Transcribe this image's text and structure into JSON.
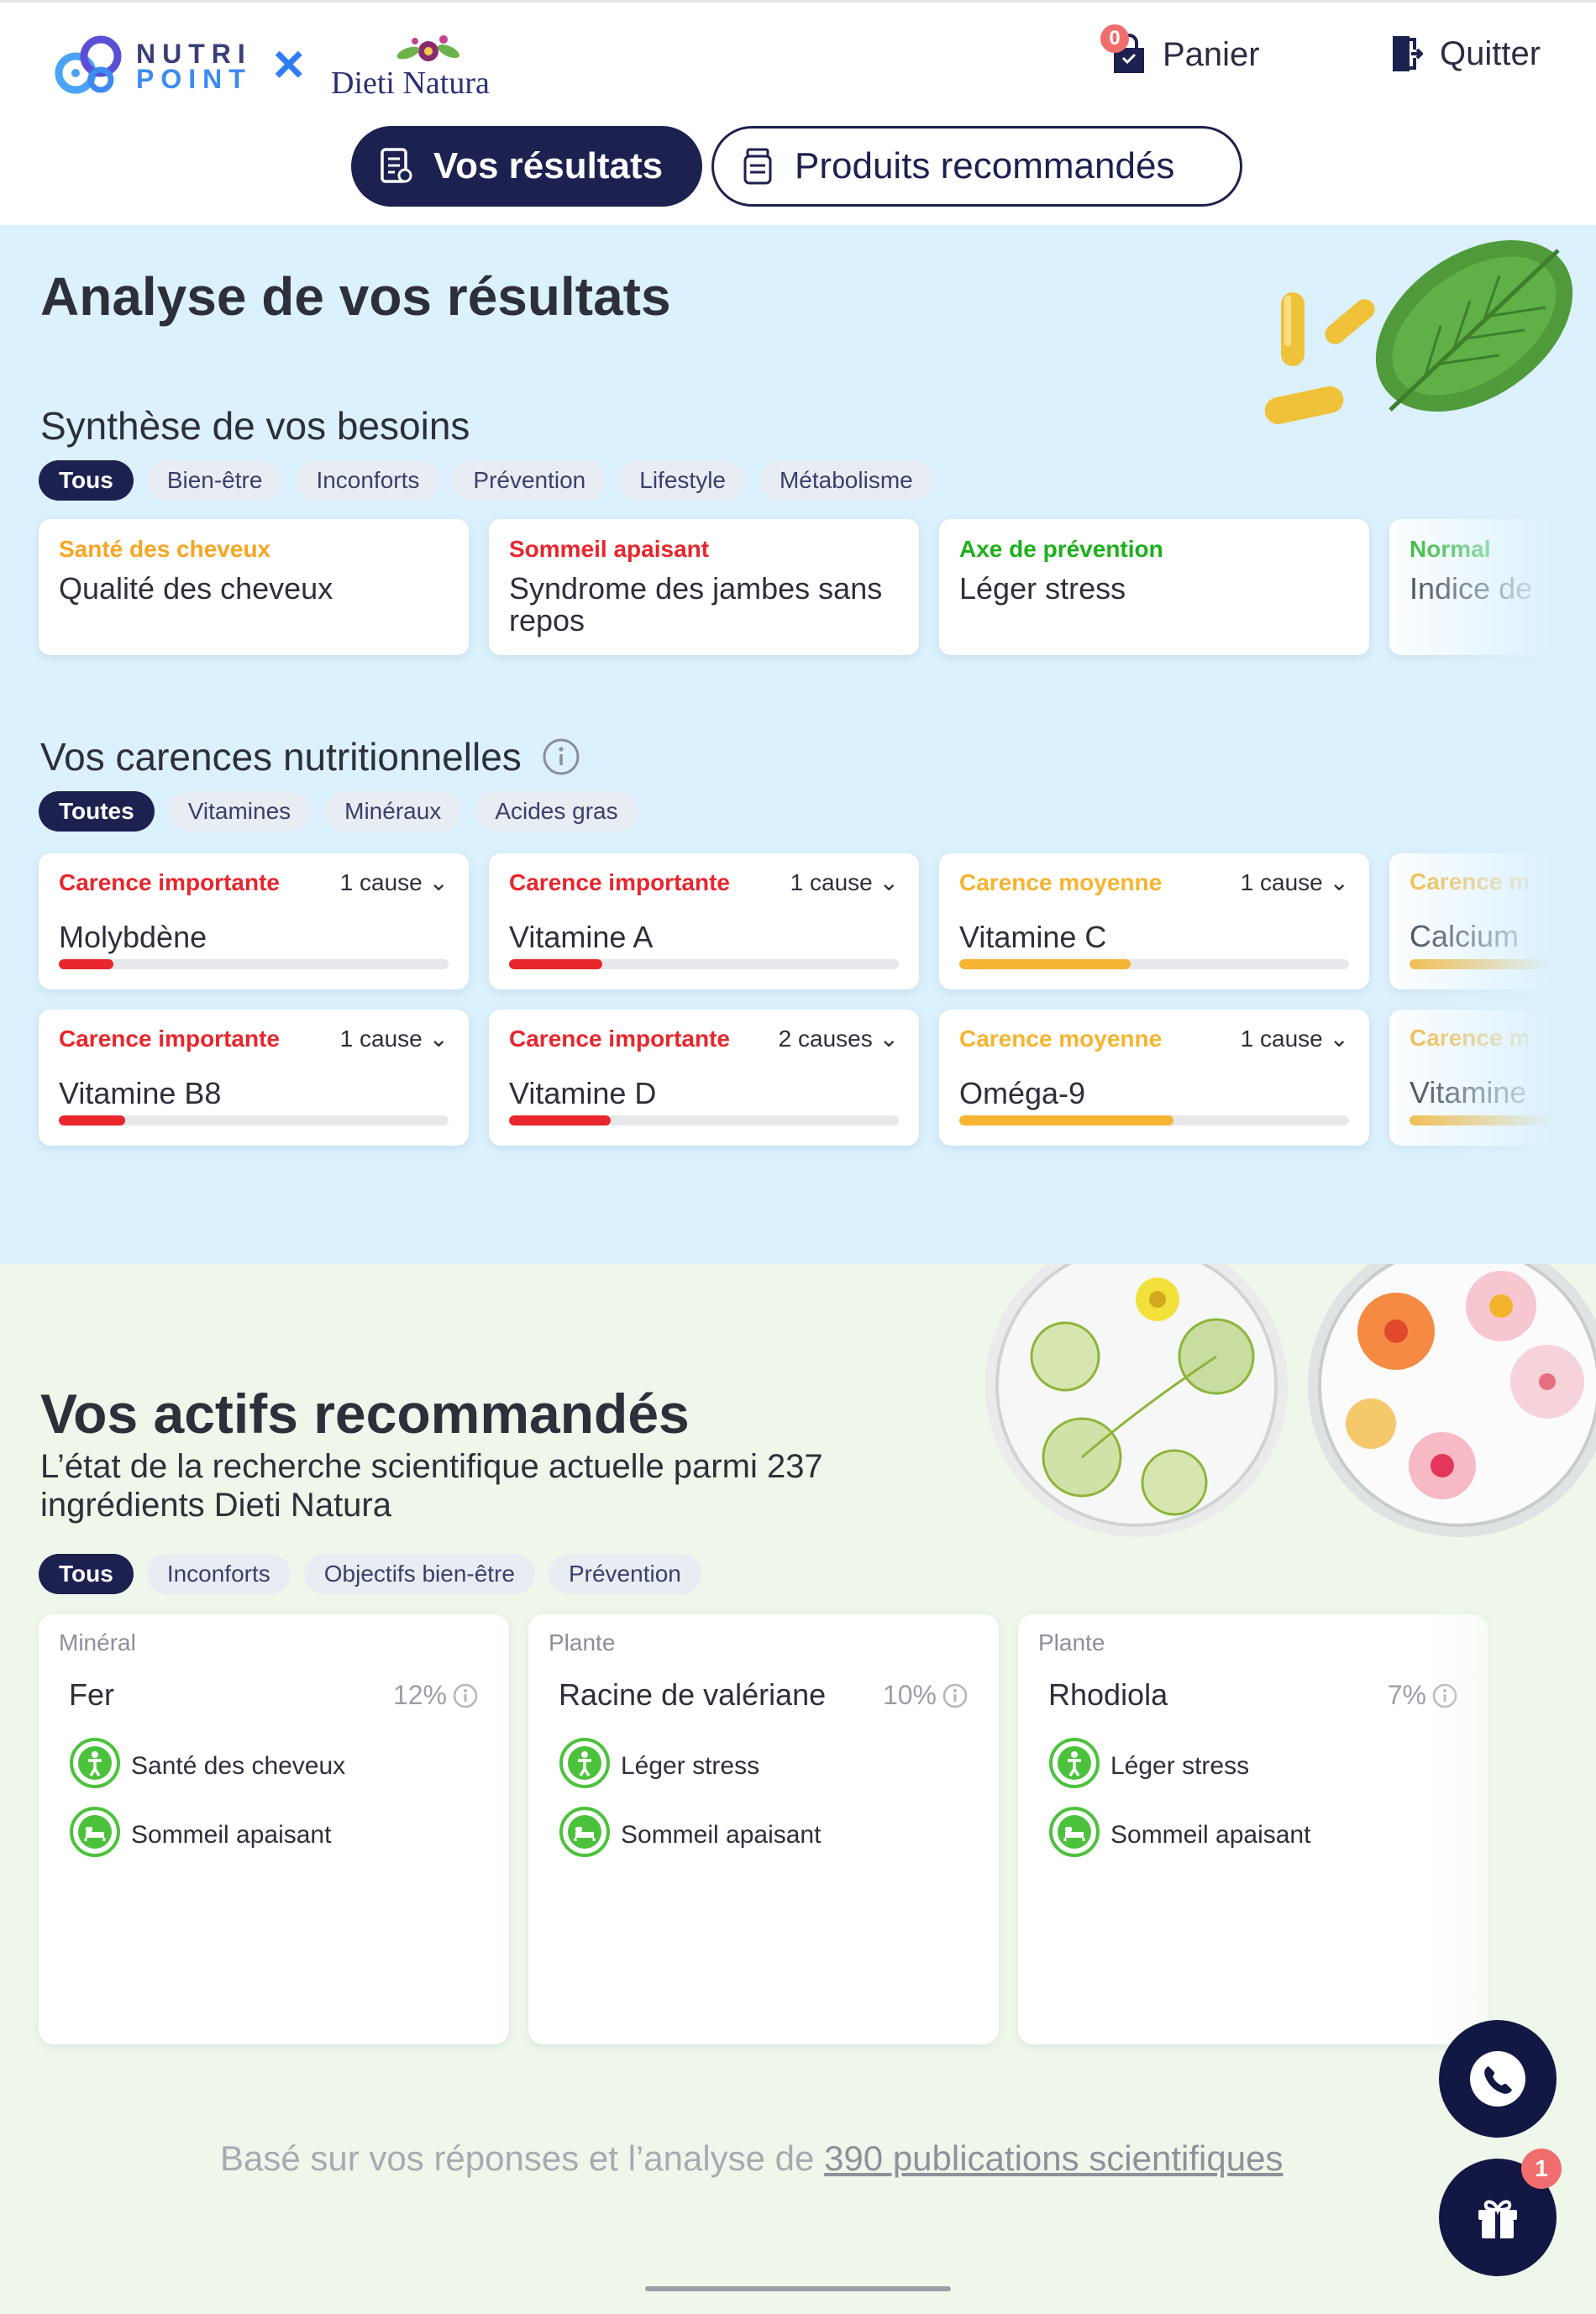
{
  "header": {
    "logo_nutri_line1": "NUTRI",
    "logo_nutri_line2": "POINT",
    "logo_x": "×",
    "logo_dieti": "Dieti Natura",
    "cart_count": "0",
    "cart_label": "Panier",
    "quit_label": "Quitter"
  },
  "tabs": {
    "results": "Vos résultats",
    "products": "Produits recommandés"
  },
  "analyse": {
    "title": "Analyse de vos résultats",
    "needs_title": "Synthèse de vos besoins",
    "needs_filters": [
      "Tous",
      "Bien-être",
      "Inconforts",
      "Prévention",
      "Lifestyle",
      "Métabolisme"
    ],
    "needs": [
      {
        "category": "Santé des cheveux",
        "text": "Qualité des cheveux",
        "color": "#f5a623"
      },
      {
        "category": "Sommeil apaisant",
        "text": "Syndrome des jambes sans repos",
        "color": "#e8262c"
      },
      {
        "category": "Axe de prévention",
        "text": "Léger stress",
        "color": "#1cb01c"
      },
      {
        "category": "Normal",
        "text": "Indice de",
        "color": "#1cb01c"
      }
    ],
    "deficiencies_title": "Vos carences nutritionnelles",
    "deficiency_filters": [
      "Toutes",
      "Vitamines",
      "Minéraux",
      "Acides gras"
    ],
    "deficiencies": [
      {
        "severity": "Carence importante",
        "cause": "1 cause",
        "name": "Molybdène",
        "level": 0.14,
        "color": "#e8262c"
      },
      {
        "severity": "Carence importante",
        "cause": "1 cause",
        "name": "Vitamine A",
        "level": 0.24,
        "color": "#e8262c"
      },
      {
        "severity": "Carence moyenne",
        "cause": "1 cause",
        "name": "Vitamine C",
        "level": 0.44,
        "color": "#f5b431"
      },
      {
        "severity": "Carence m",
        "cause": "",
        "name": "Calcium",
        "level": 0.4,
        "color": "#f5b431"
      },
      {
        "severity": "Carence importante",
        "cause": "1 cause",
        "name": "Vitamine B8",
        "level": 0.17,
        "color": "#e8262c"
      },
      {
        "severity": "Carence importante",
        "cause": "2 causes",
        "name": "Vitamine D",
        "level": 0.26,
        "color": "#e8262c"
      },
      {
        "severity": "Carence moyenne",
        "cause": "1 cause",
        "name": "Oméga-9",
        "level": 0.55,
        "color": "#f5b431"
      },
      {
        "severity": "Carence m",
        "cause": "",
        "name": "Vitamine",
        "level": 0.4,
        "color": "#f5b431"
      }
    ]
  },
  "actifs": {
    "title": "Vos actifs recommandés",
    "subtitle": "L’état de la recherche scientifique actuelle parmi 237 ingrédients Dieti Natura",
    "filters": [
      "Tous",
      "Inconforts",
      "Objectifs bien-être",
      "Prévention"
    ],
    "items": [
      {
        "type": "Minéral",
        "name": "Fer",
        "pct": "12%",
        "benefits": [
          {
            "icon": "person-icon",
            "label": "Santé des cheveux"
          },
          {
            "icon": "bed-icon",
            "label": "Sommeil apaisant"
          }
        ]
      },
      {
        "type": "Plante",
        "name": "Racine de valériane",
        "pct": "10%",
        "benefits": [
          {
            "icon": "person-icon",
            "label": "Léger stress"
          },
          {
            "icon": "bed-icon",
            "label": "Sommeil apaisant"
          }
        ]
      },
      {
        "type": "Plante",
        "name": "Rhodiola",
        "pct": "7%",
        "benefits": [
          {
            "icon": "person-icon",
            "label": "Léger stress"
          },
          {
            "icon": "bed-icon",
            "label": "Sommeil apaisant"
          }
        ]
      }
    ]
  },
  "footer": {
    "note_prefix": "Basé sur vos réponses et l’analyse de ",
    "note_link": "390 publications scientifiques",
    "gift_badge": "1"
  },
  "colors": {
    "navy": "#1c2150",
    "analyse_bg": "#dbf1fd",
    "actifs_bg": "#eef7ea",
    "important": "#e8262c",
    "medium": "#f5b431",
    "prevention": "#1cb01c"
  }
}
